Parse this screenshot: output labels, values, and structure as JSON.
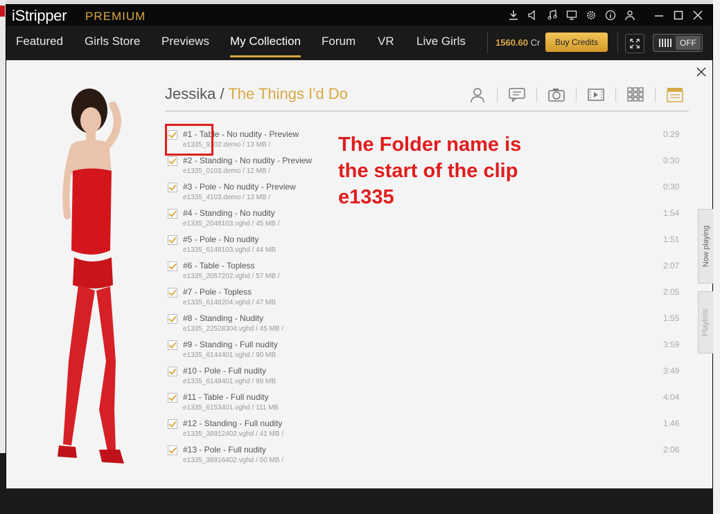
{
  "app": {
    "title": "iStripper",
    "edition": "PREMIUM"
  },
  "nav": {
    "items": [
      {
        "label": "Featured"
      },
      {
        "label": "Girls Store"
      },
      {
        "label": "Previews"
      },
      {
        "label": "My Collection",
        "active": true
      },
      {
        "label": "Forum"
      },
      {
        "label": "VR"
      },
      {
        "label": "Live Girls"
      }
    ],
    "credits_value": "1560.60",
    "credits_unit": "Cr",
    "buy_label": "Buy Credits",
    "toggle_label": "OFF"
  },
  "header": {
    "model": "Jessika",
    "separator": "/",
    "album": "The Things I'd Do"
  },
  "clips": [
    {
      "title": "#1 - Table - No nudity - Preview",
      "meta": "e1335_9102.demo / 13 MB /",
      "duration": "0:29"
    },
    {
      "title": "#2 - Standing - No nudity - Preview",
      "meta": "e1335_0103.demo / 12 MB /",
      "duration": "0:30"
    },
    {
      "title": "#3 - Pole - No nudity - Preview",
      "meta": "e1335_4103.demo / 13 MB /",
      "duration": "0:30"
    },
    {
      "title": "#4 - Standing - No nudity",
      "meta": "e1335_2048103.vghd / 45 MB /",
      "duration": "1:54"
    },
    {
      "title": "#5 - Pole - No nudity",
      "meta": "e1335_6148103.vghd / 44 MB",
      "duration": "1:51"
    },
    {
      "title": "#6 - Table - Topless",
      "meta": "e1335_2057202.vghd / 57 MB /",
      "duration": "2:07"
    },
    {
      "title": "#7 - Pole - Topless",
      "meta": "e1335_6148204.vghd / 47 MB",
      "duration": "2:05"
    },
    {
      "title": "#8 - Standing - Nudity",
      "meta": "e1335_22528304.vghd / 45 MB /",
      "duration": "1:55"
    },
    {
      "title": "#9 - Standing - Full nudity",
      "meta": "e1335_6144401.vghd / 90 MB",
      "duration": "3:59"
    },
    {
      "title": "#10 - Pole - Full nudity",
      "meta": "e1335_6148401.vghd / 89 MB",
      "duration": "3:49"
    },
    {
      "title": "#11 - Table - Full nudity",
      "meta": "e1335_6153401.vghd / 111 MB",
      "duration": "4:04"
    },
    {
      "title": "#12 - Standing - Full nudity",
      "meta": "e1335_38912402.vghd / 41 MB /",
      "duration": "1:46"
    },
    {
      "title": "#13 - Pole - Full nudity",
      "meta": "e1335_38916402.vghd / 50 MB /",
      "duration": "2:06"
    }
  ],
  "annotation": {
    "line1": "The Folder name is",
    "line2": "the start of the clip",
    "line3": "e1335"
  },
  "side_tabs": {
    "now_playing": "Now playing",
    "playlists": "Playlists"
  },
  "colors": {
    "accent": "#d8a845",
    "annotation_red": "#e01d1d",
    "titlebar_bg": "#0a0a0a",
    "navbar_bg": "#1a1a1a"
  }
}
